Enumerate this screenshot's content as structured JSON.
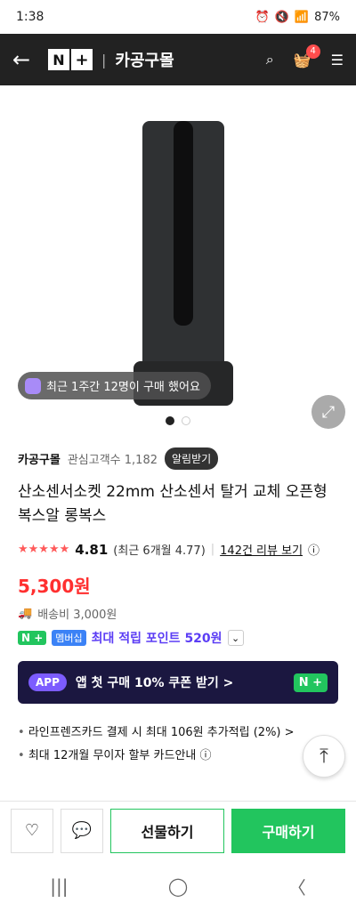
{
  "status": {
    "time": "1:38",
    "battery": "87%"
  },
  "header": {
    "store": "카공구몰"
  },
  "cart": {
    "count": "4"
  },
  "hero": {
    "activity": "최근 1주간 12명이 구매 했어요"
  },
  "store": {
    "name": "카공구몰",
    "followers": "관심고객수 1,182",
    "alarm": "알림받기"
  },
  "product": {
    "title": "산소센서소켓 22mm 산소센서 탈거 교체 오픈형 복스알 롱복스",
    "rating": "4.81",
    "recent_rating": "(최근 6개월 4.77)",
    "reviews": "142건 리뷰 보기",
    "price": "5,300원",
    "shipping": "배송비 3,000원",
    "points": "최대 적립 포인트 520원"
  },
  "banner": {
    "app": "APP",
    "text": "앱 첫 구매 10% 쿠폰 받기 >"
  },
  "bullets": [
    "라인프렌즈카드 결제 시 최대 106원 추가적립 (2%) >",
    "최대 12개월 무이자 할부 카드안내 ⓘ"
  ],
  "actions": {
    "gift": "선물하기",
    "buy": "구매하기"
  },
  "labels": {
    "np": "N +",
    "membership": "멤버십"
  }
}
